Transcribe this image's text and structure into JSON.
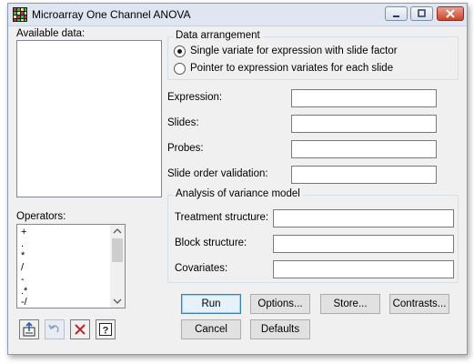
{
  "window": {
    "title": "Microarray One Channel ANOVA"
  },
  "available_data": {
    "label": "Available data:"
  },
  "operators": {
    "label": "Operators:",
    "items": [
      "+",
      ".",
      "*",
      "/",
      "-",
      ".*",
      "-/"
    ]
  },
  "data_arrangement": {
    "title": "Data arrangement",
    "options": [
      {
        "label": "Single variate for expression with slide factor",
        "selected": true
      },
      {
        "label": "Pointer to expression variates for each slide",
        "selected": false
      }
    ]
  },
  "fields": {
    "expression": {
      "label": "Expression:",
      "value": ""
    },
    "slides": {
      "label": "Slides:",
      "value": ""
    },
    "probes": {
      "label": "Probes:",
      "value": ""
    },
    "slide_order": {
      "label": "Slide order validation:",
      "value": ""
    }
  },
  "anova_model": {
    "title": "Analysis of variance model",
    "treatment": {
      "label": "Treatment structure:",
      "value": ""
    },
    "block": {
      "label": "Block structure:",
      "value": ""
    },
    "covariates": {
      "label": "Covariates:",
      "value": ""
    }
  },
  "buttons": {
    "run": "Run",
    "options": "Options...",
    "store": "Store...",
    "contrasts": "Contrasts...",
    "cancel": "Cancel",
    "defaults": "Defaults"
  },
  "icons": {
    "app": "microarray-grid-icon",
    "transfer": "transfer-data-icon",
    "undo": "undo-icon",
    "clear": "clear-icon",
    "help": "help-icon"
  },
  "colors": {
    "titlebar": "#dfe6f2",
    "close_button": "#c9442c",
    "default_button_border": "#3c7fb1"
  }
}
